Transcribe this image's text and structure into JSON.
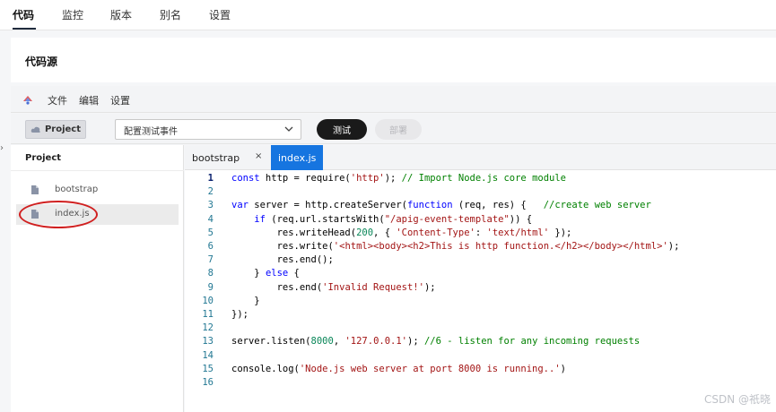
{
  "top_tabs": [
    "代码",
    "监控",
    "版本",
    "别名",
    "设置"
  ],
  "source_title": "代码源",
  "menu": [
    "文件",
    "编辑",
    "设置"
  ],
  "toolbar": {
    "project_label": "Project",
    "event_select_value": "配置测试事件",
    "test_label": "测试",
    "deploy_label": "部署"
  },
  "explorer": {
    "header": "Project",
    "files": [
      "bootstrap",
      "index.js"
    ],
    "active_file": "index.js"
  },
  "editor": {
    "tabs": [
      "bootstrap",
      "index.js"
    ],
    "active_tab": "index.js",
    "close_glyph": "×",
    "lines": [
      {
        "n": "1",
        "text": "const http = require('http'); // Import Node.js core module"
      },
      {
        "n": "2",
        "text": ""
      },
      {
        "n": "3",
        "text": "var server = http.createServer(function (req, res) {   //create web server"
      },
      {
        "n": "4",
        "text": "    if (req.url.startsWith(\"/apig-event-template\")) {"
      },
      {
        "n": "5",
        "text": "        res.writeHead(200, { 'Content-Type': 'text/html' });"
      },
      {
        "n": "6",
        "text": "        res.write('<html><body><h2>This is http function.</h2></body></html>');"
      },
      {
        "n": "7",
        "text": "        res.end();"
      },
      {
        "n": "8",
        "text": "    } else {"
      },
      {
        "n": "9",
        "text": "        res.end('Invalid Request!');"
      },
      {
        "n": "10",
        "text": "    }"
      },
      {
        "n": "11",
        "text": "});"
      },
      {
        "n": "12",
        "text": ""
      },
      {
        "n": "13",
        "text": "server.listen(8000, '127.0.0.1'); //6 - listen for any incoming requests"
      },
      {
        "n": "14",
        "text": ""
      },
      {
        "n": "15",
        "text": "console.log('Node.js web server at port 8000 is running..')"
      },
      {
        "n": "16",
        "text": ""
      }
    ]
  },
  "watermark": "CSDN @祇晓",
  "colors": {
    "accent": "#1675e0",
    "highlight": "#d01f1f",
    "dark_button": "#1a1a1a"
  }
}
